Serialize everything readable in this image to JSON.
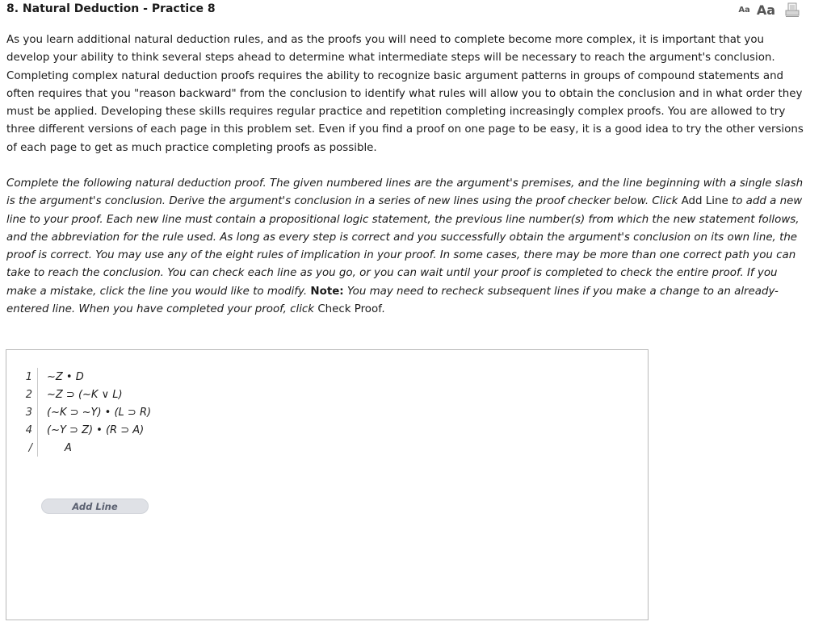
{
  "header": {
    "title": "8.  Natural Deduction - Practice 8",
    "font_small_label": "Aa",
    "font_large_label": "Aa",
    "print_icon": "printer-icon"
  },
  "intro": {
    "text": "As you learn additional natural deduction rules, and as the proofs you will need to complete become more complex, it is important that you develop your ability to think several steps ahead to determine what intermediate steps will be necessary to reach the argument's conclusion. Completing complex natural deduction proofs requires the ability to recognize basic argument patterns in groups of compound statements and often requires that you \"reason backward\" from the conclusion to identify what rules will allow you to obtain the conclusion and in what order they must be applied. Developing these skills requires regular practice and repetition completing increasingly complex proofs. You are allowed to try three different versions of each page in this problem set. Even if you find a proof on one page to be easy, it is a good idea to try the other versions of each page to get as much practice completing proofs as possible."
  },
  "instructions": {
    "part1": "Complete the following natural deduction proof. The given numbered lines are the argument's premises, and the line beginning with a single slash is the argument's conclusion. Derive the argument's conclusion in a series of new lines using the proof checker below. Click ",
    "add_line_ref": "Add Line",
    "part2": " to add a new line to your proof. Each new line must contain a propositional logic statement, the previous line number(s) from which the new statement follows, and the abbreviation for the rule used. As long as every step is correct and you successfully obtain the argument's conclusion on its own line, the proof is correct. You may use any of the eight rules of implication in your proof. In some cases, there may be more than one correct path you can take to reach the conclusion. You can check each line as you go, or you can wait until your proof is completed to check the entire proof. If you make a mistake, click the line you would like to modify. ",
    "note_label": "Note:",
    "part3": " You may need to recheck subsequent lines if you make a change to an already-entered line. When you have completed your proof, click ",
    "check_proof_ref": "Check Proof",
    "part4": "."
  },
  "proof": {
    "lines": [
      {
        "num": "1",
        "statement": "~Z • D"
      },
      {
        "num": "2",
        "statement": "~Z ⊃ (~K ∨ L)"
      },
      {
        "num": "3",
        "statement": "(~K ⊃ ~Y) • (L ⊃ R)"
      },
      {
        "num": "4",
        "statement": "(~Y ⊃ Z) • (R ⊃ A)"
      }
    ],
    "conclusion": {
      "num": "/",
      "statement": "A"
    },
    "add_line_label": "Add Line"
  }
}
